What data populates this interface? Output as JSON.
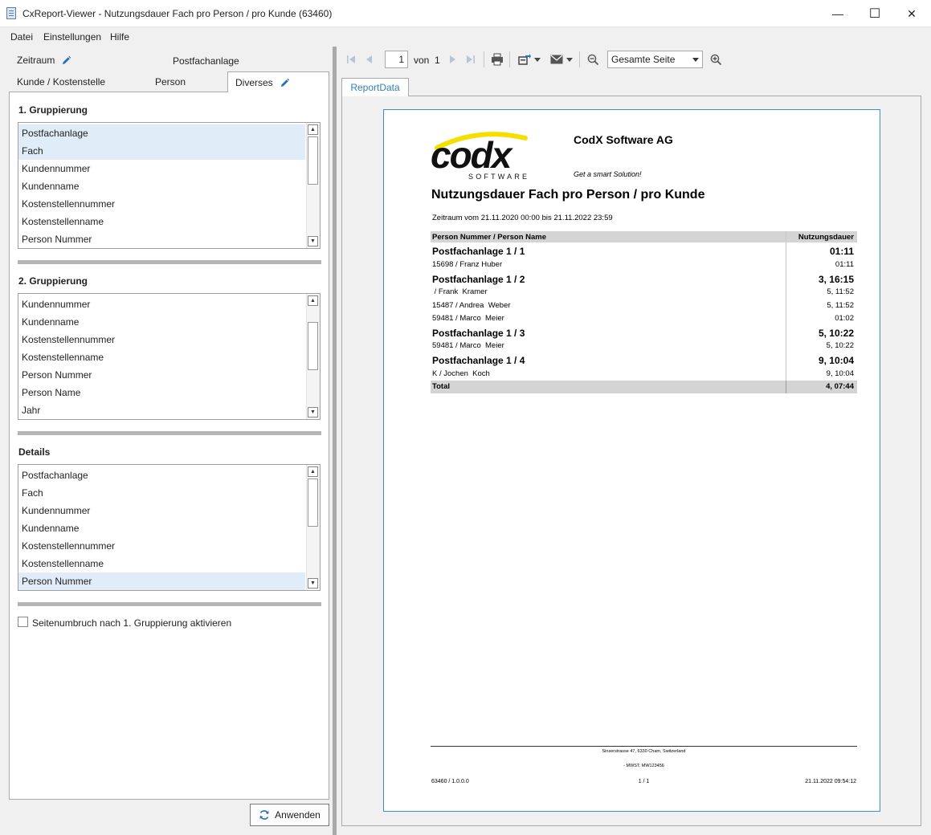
{
  "window": {
    "title": "CxReport-Viewer - Nutzungsdauer Fach pro Person / pro Kunde (63460)",
    "minimize": "—",
    "maximize": "☐",
    "close": "✕"
  },
  "menu": [
    "Datei",
    "Einstellungen",
    "Hilfe"
  ],
  "filter_tabs": {
    "zeitraum": "Zeitraum",
    "postfachanlage": "Postfachanlage",
    "kunde": "Kunde / Kostenstelle",
    "person": "Person",
    "diverses": "Diverses"
  },
  "grouping1": {
    "title": "1. Gruppierung",
    "items": [
      "Postfachanlage",
      "Fach",
      "Kundennummer",
      "Kundenname",
      "Kostenstellennummer",
      "Kostenstellenname",
      "Person Nummer"
    ]
  },
  "grouping2": {
    "title": "2. Gruppierung",
    "items": [
      "Kundennummer",
      "Kundenname",
      "Kostenstellennummer",
      "Kostenstellenname",
      "Person Nummer",
      "Person Name",
      "Jahr"
    ]
  },
  "details": {
    "title": "Details",
    "items": [
      "Postfachanlage",
      "Fach",
      "Kundennummer",
      "Kundenname",
      "Kostenstellennummer",
      "Kostenstellenname",
      "Person Nummer"
    ]
  },
  "page_break_label": "Seitenumbruch nach 1. Gruppierung aktivieren",
  "apply_label": "Anwenden",
  "toolbar": {
    "page_value": "1",
    "of_label": "von",
    "total_pages": "1",
    "zoom_value": "Gesamte Seite"
  },
  "report_tab": "ReportData",
  "report": {
    "logo_text": "codx",
    "logo_sub": "SOFTWARE",
    "company": "CodX Software AG",
    "slogan": "Get a smart Solution!",
    "title": "Nutzungsdauer Fach pro Person / pro Kunde",
    "period": "Zeitraum vom 21.11.2020 00:00 bis 21.11.2022 23:59",
    "col_person": "Person Nummer / Person Name",
    "col_duration": "Nutzungsdauer",
    "rows": [
      {
        "group": true,
        "label": "Postfachanlage 1 / 1",
        "value": "01:11"
      },
      {
        "group": false,
        "label": "15698 / Franz  Huber",
        "value": "01:11"
      },
      {
        "group": true,
        "label": "Postfachanlage 1 / 2",
        "value": "3, 16:15"
      },
      {
        "group": false,
        "label": " / Frank  Kramer",
        "value": "5, 11:52"
      },
      {
        "group": false,
        "label": "15487 / Andrea  Weber",
        "value": "5, 11:52"
      },
      {
        "group": false,
        "label": "59481 / Marco  Meier",
        "value": "01:02"
      },
      {
        "group": true,
        "label": "Postfachanlage 1 / 3",
        "value": "5, 10:22"
      },
      {
        "group": false,
        "label": "59481 / Marco  Meier",
        "value": "5, 10:22"
      },
      {
        "group": true,
        "label": "Postfachanlage 1 / 4",
        "value": "9, 10:04"
      },
      {
        "group": false,
        "label": "K / Jochen  Koch",
        "value": "9, 10:04"
      }
    ],
    "total_label": "Total",
    "total_value": "4, 07:44",
    "footer_address": "Sinserstrasse 47, 6330 Cham, Switzerland",
    "footer_vat": "- MWST: MW123456",
    "footer_version": "63460 / 1.0.0.0",
    "footer_page": "1 / 1",
    "footer_date": "21.11.2022 09:54:12"
  }
}
